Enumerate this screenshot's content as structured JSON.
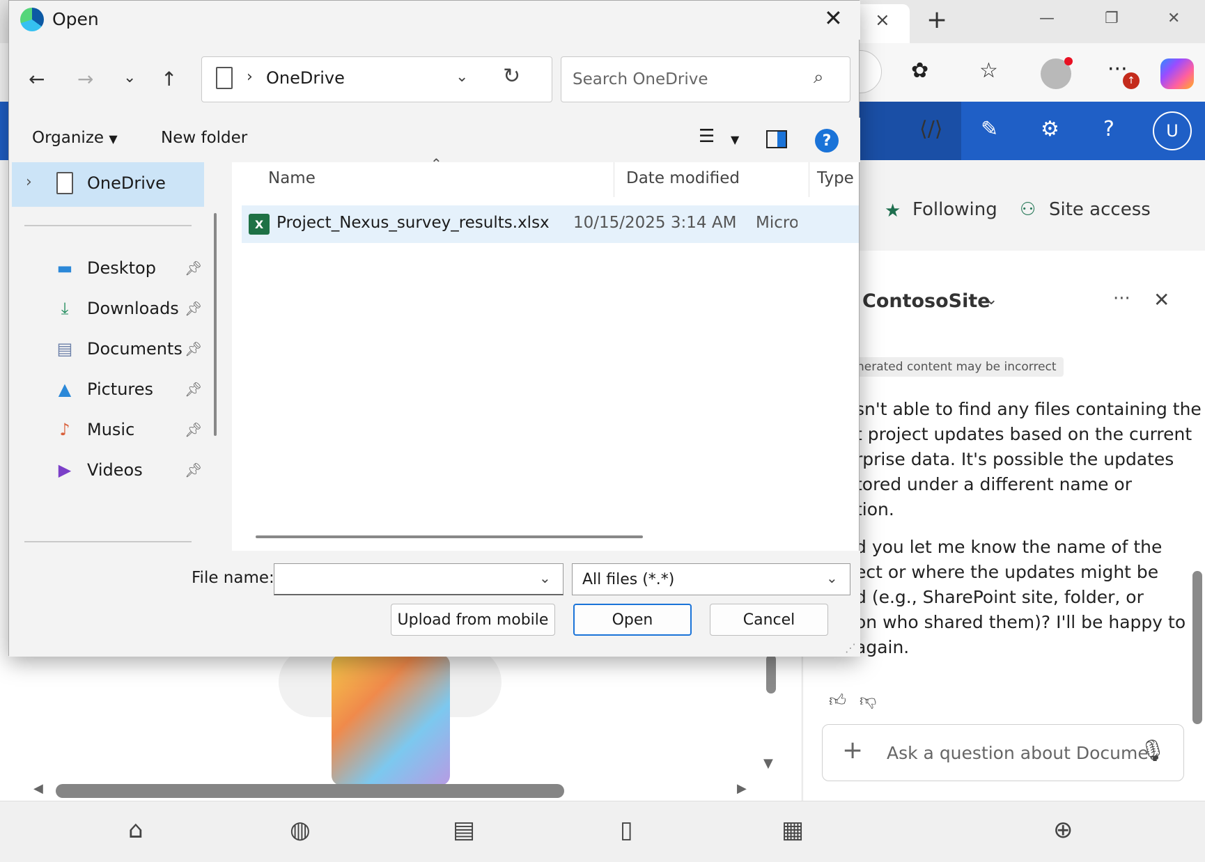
{
  "browser": {
    "tab_close": "×",
    "new_tab": "+",
    "win_min": "—",
    "win_restore": "❐",
    "win_close": "✕"
  },
  "sharepoint": {
    "following": "Following",
    "site_access": "Site access",
    "avatar_letter": "U"
  },
  "copilot": {
    "title": "ContosoSite",
    "disclaimer": "nerated content may be incorrect",
    "message_lines_1": [
      "sn't able to find any files containing the",
      "t project updates based on the current",
      "rprise data. It's possible the updates",
      "tored under a different name or",
      "tion."
    ],
    "message_lines_2": [
      "d you let me know the name of the",
      "ect or where the updates might be",
      "d (e.g., SharePoint site, folder, or",
      "on who shared them)? I'll be happy to",
      "again."
    ],
    "ask_placeholder": "Ask a question about Docume"
  },
  "dialog": {
    "title": "Open",
    "path": "OneDrive",
    "search_placeholder": "Search OneDrive",
    "organize": "Organize",
    "new_folder": "New folder",
    "help": "?",
    "nav": {
      "selected": "OneDrive",
      "quick_access": [
        {
          "label": "Desktop",
          "icon": "desktop-icon"
        },
        {
          "label": "Downloads",
          "icon": "downloads-icon"
        },
        {
          "label": "Documents",
          "icon": "documents-icon"
        },
        {
          "label": "Pictures",
          "icon": "pictures-icon"
        },
        {
          "label": "Music",
          "icon": "music-icon"
        },
        {
          "label": "Videos",
          "icon": "videos-icon"
        }
      ]
    },
    "columns": {
      "name": "Name",
      "date": "Date modified",
      "type": "Type"
    },
    "files": [
      {
        "name": "Project_Nexus_survey_results.xlsx",
        "date": "10/15/2025 3:14 AM",
        "type": "Micro"
      }
    ],
    "file_name_label": "File name:",
    "file_name_value": "",
    "file_type": "All files (*.*)",
    "upload_button": "Upload from mobile",
    "open_button": "Open",
    "cancel_button": "Cancel"
  },
  "colors": {
    "accent": "#1a73d8",
    "sharepoint_blue": "#1f5fc6",
    "selection": "#cce4f7",
    "excel_green": "#1e7145"
  }
}
